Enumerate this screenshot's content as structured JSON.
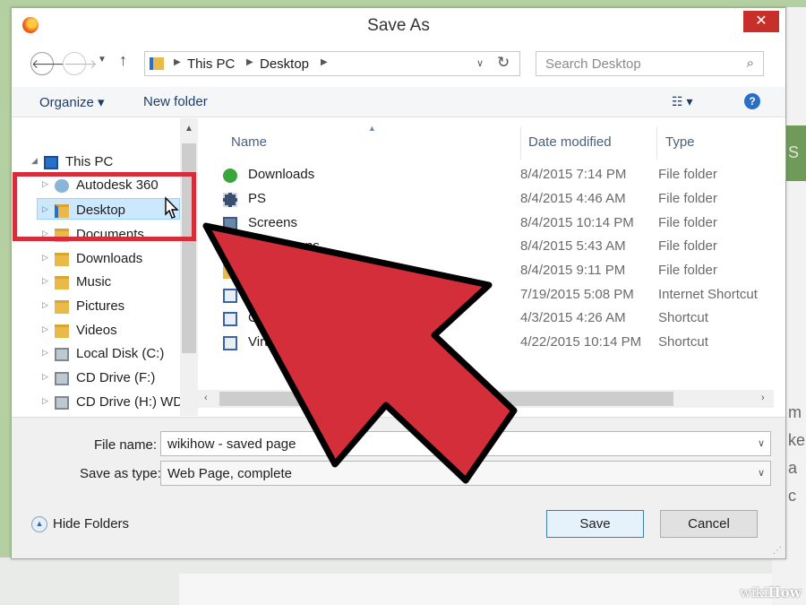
{
  "window": {
    "title": "Save As",
    "close_glyph": "✕"
  },
  "nav": {
    "breadcrumb": [
      "This PC",
      "Desktop"
    ],
    "search_placeholder": "Search Desktop"
  },
  "toolbar": {
    "organize": "Organize ▾",
    "new_folder": "New folder",
    "view_glyph": "☷ ▾",
    "help_glyph": "?"
  },
  "tree": [
    {
      "label": "This PC",
      "icon": "pc-icon",
      "level": 0,
      "arrow": "◢"
    },
    {
      "label": "Autodesk 360",
      "icon": "cloud-icon",
      "level": 1,
      "arrow": "▷"
    },
    {
      "label": "Desktop",
      "icon": "folder-icon",
      "level": 1,
      "arrow": "▷",
      "selected": true
    },
    {
      "label": "Documents",
      "icon": "folder-icon",
      "level": 1,
      "arrow": "▷"
    },
    {
      "label": "Downloads",
      "icon": "folder-icon",
      "level": 1,
      "arrow": "▷"
    },
    {
      "label": "Music",
      "icon": "folder-icon",
      "level": 1,
      "arrow": "▷"
    },
    {
      "label": "Pictures",
      "icon": "folder-icon",
      "level": 1,
      "arrow": "▷"
    },
    {
      "label": "Videos",
      "icon": "folder-icon",
      "level": 1,
      "arrow": "▷"
    },
    {
      "label": "Local Disk (C:)",
      "icon": "disk-icon",
      "level": 1,
      "arrow": "▷"
    },
    {
      "label": "CD Drive (F:)",
      "icon": "disk-icon",
      "level": 1,
      "arrow": "▷"
    },
    {
      "label": "CD Drive (H:) WD",
      "icon": "disk-icon",
      "level": 1,
      "arrow": "▷"
    }
  ],
  "columns": {
    "name": "Name",
    "date": "Date modified",
    "type": "Type"
  },
  "files": [
    {
      "name": "Downloads",
      "date": "8/4/2015 7:14 PM",
      "type": "File folder",
      "icon": "download-folder-icon"
    },
    {
      "name": "PS",
      "date": "8/4/2015 4:46 AM",
      "type": "File folder",
      "icon": "film-folder-icon"
    },
    {
      "name": "Screens",
      "date": "8/4/2015 10:14 PM",
      "type": "File folder",
      "icon": "screen-folder-icon"
    },
    {
      "name": "Icons",
      "date": "8/4/2015 5:43 AM",
      "type": "File folder",
      "icon": "folder-icon"
    },
    {
      "name": "",
      "date": "8/4/2015 9:11 PM",
      "type": "File folder",
      "icon": "folder-icon"
    },
    {
      "name": "",
      "date": "7/19/2015 5:08 PM",
      "type": "Internet Shortcut",
      "icon": "shortcut-icon"
    },
    {
      "name": "C",
      "date": "4/3/2015 4:26 AM",
      "type": "Shortcut",
      "icon": "shortcut-icon"
    },
    {
      "name": "Virt",
      "date": "4/22/2015 10:14 PM",
      "type": "Shortcut",
      "icon": "shortcut-icon"
    }
  ],
  "form": {
    "filename_label": "File name:",
    "filename_value": "wikihow - saved page",
    "savetype_label": "Save as type:",
    "savetype_value": "Web Page, complete",
    "hide_folders": "Hide Folders",
    "save": "Save",
    "cancel": "Cancel"
  },
  "background_page_letters": [
    "S",
    "m",
    "ke",
    "a",
    "c"
  ],
  "watermark": {
    "prefix": "wiki",
    "suffix": "How"
  },
  "colors": {
    "accent": "#d42e3b",
    "selection": "#cce8ff",
    "close": "#c7302a"
  }
}
